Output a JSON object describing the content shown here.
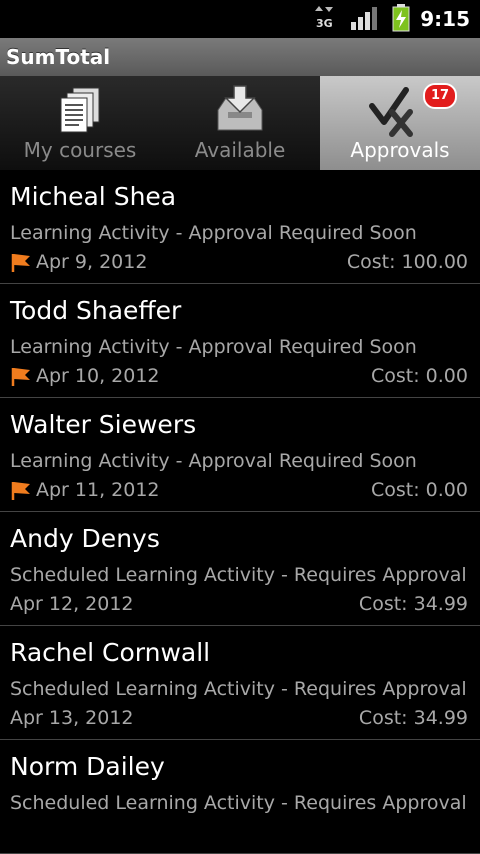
{
  "status_bar": {
    "network_label": "3G",
    "time": "9:15"
  },
  "app": {
    "title": "SumTotal"
  },
  "tabs": [
    {
      "label": "My courses",
      "icon": "documents-icon",
      "selected": false
    },
    {
      "label": "Available",
      "icon": "download-tray-icon",
      "selected": false
    },
    {
      "label": "Approvals",
      "icon": "check-x-icon",
      "selected": true,
      "badge": "17"
    }
  ],
  "approvals": [
    {
      "name": "Micheal Shea",
      "description": "Learning Activity - Approval Required Soon",
      "date": "Apr 9, 2012",
      "cost": "Cost: 100.00",
      "flagged": true
    },
    {
      "name": "Todd Shaeffer",
      "description": "Learning Activity - Approval Required Soon",
      "date": "Apr 10, 2012",
      "cost": "Cost: 0.00",
      "flagged": true
    },
    {
      "name": "Walter Siewers",
      "description": "Learning Activity - Approval Required Soon",
      "date": "Apr 11, 2012",
      "cost": "Cost: 0.00",
      "flagged": true
    },
    {
      "name": "Andy Denys",
      "description": "Scheduled Learning Activity - Requires Approval",
      "date": "Apr 12, 2012",
      "cost": "Cost: 34.99",
      "flagged": false
    },
    {
      "name": "Rachel Cornwall",
      "description": "Scheduled Learning Activity - Requires Approval",
      "date": "Apr 13, 2012",
      "cost": "Cost: 34.99",
      "flagged": false
    },
    {
      "name": "Norm Dailey",
      "description": "Scheduled Learning Activity - Requires Approval",
      "date": "",
      "cost": "",
      "flagged": false
    }
  ],
  "colors": {
    "flag": "#f07c1e",
    "badge": "#e21d1d",
    "battery": "#7ec21e"
  }
}
